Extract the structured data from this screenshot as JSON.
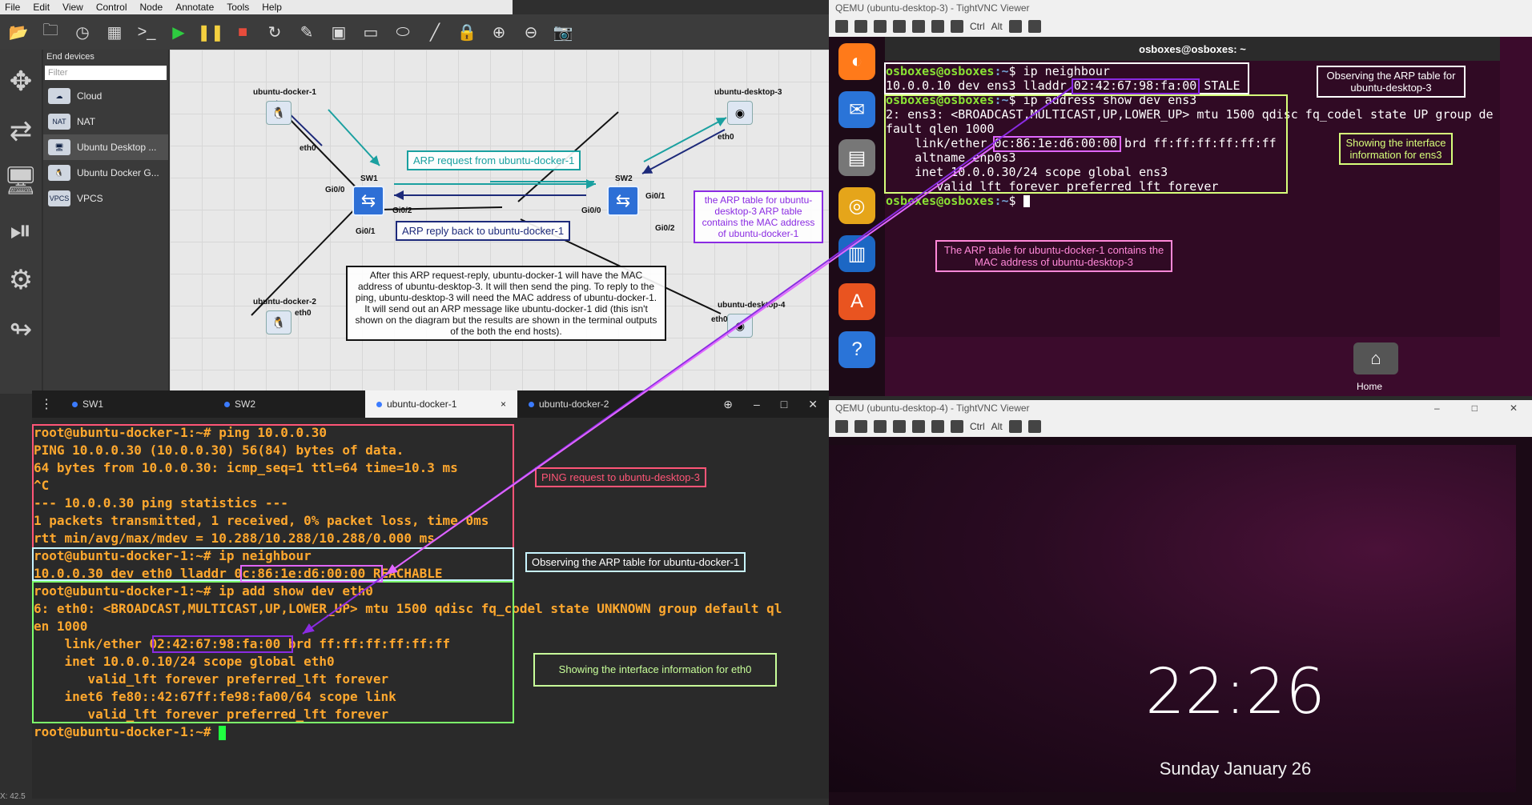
{
  "menu": [
    "File",
    "Edit",
    "View",
    "Control",
    "Node",
    "Annotate",
    "Tools",
    "Help"
  ],
  "devices_panel": {
    "title": "End devices",
    "filter_placeholder": "Filter",
    "items": [
      "Cloud",
      "NAT",
      "Ubuntu Desktop ...",
      "Ubuntu Docker G...",
      "VPCS"
    ]
  },
  "topology": {
    "nodes": {
      "d1": "ubuntu-docker-1",
      "d2": "ubuntu-docker-2",
      "d3": "ubuntu-desktop-3",
      "d4": "ubuntu-desktop-4",
      "sw1": "SW1",
      "sw2": "SW2"
    },
    "ports": {
      "eth0": "eth0",
      "gi00": "Gi0/0",
      "gi01": "Gi0/1",
      "gi02": "Gi0/2"
    },
    "notes": {
      "arp_request": "ARP request from ubuntu-docker-1",
      "arp_reply": "ARP reply back to ubuntu-docker-1",
      "arp_table_d3": "the ARP table for ubuntu-desktop-3 ARP table contains the MAC address of ubuntu-docker-1",
      "explanation": "After this ARP request-reply, ubuntu-docker-1 will have the MAC address of ubuntu-desktop-3. It will then send the ping. To reply to the ping, ubuntu-desktop-3 will need the MAC address of ubuntu-docker-1. It will send out an ARP message like ubuntu-docker-1 did (this isn't shown on the diagram but the results are shown in the terminal outputs of the both the end hosts)."
    }
  },
  "terminal": {
    "tabs": [
      "SW1",
      "SW2",
      "ubuntu-docker-1",
      "ubuntu-docker-2"
    ],
    "active_tab": "ubuntu-docker-1",
    "lines": [
      "root@ubuntu-docker-1:~# ping 10.0.0.30",
      "PING 10.0.0.30 (10.0.0.30) 56(84) bytes of data.",
      "64 bytes from 10.0.0.30: icmp_seq=1 ttl=64 time=10.3 ms",
      "^C",
      "--- 10.0.0.30 ping statistics ---",
      "1 packets transmitted, 1 received, 0% packet loss, time 0ms",
      "rtt min/avg/max/mdev = 10.288/10.288/10.288/0.000 ms",
      "root@ubuntu-docker-1:~# ip neighbour",
      "10.0.0.30 dev eth0 lladdr 0c:86:1e:d6:00:00 REACHABLE",
      "root@ubuntu-docker-1:~# ip add show dev eth0",
      "6: eth0: <BROADCAST,MULTICAST,UP,LOWER_UP> mtu 1500 qdisc fq_codel state UNKNOWN group default ql",
      "en 1000",
      "    link/ether 02:42:67:98:fa:00 brd ff:ff:ff:ff:ff:ff",
      "    inet 10.0.0.10/24 scope global eth0",
      "       valid_lft forever preferred_lft forever",
      "    inet6 fe80::42:67ff:fe98:fa00/64 scope link",
      "       valid_lft forever preferred_lft forever",
      "root@ubuntu-docker-1:~# "
    ],
    "notes": {
      "ping": "PING request to ubuntu-desktop-3",
      "arp": "Observing the ARP table for ubuntu-docker-1",
      "iface": "Showing the interface information for eth0"
    }
  },
  "vnc_top": {
    "title": "QEMU (ubuntu-desktop-3) - TightVNC Viewer",
    "terminal_title": "osboxes@osboxes: ~",
    "prompt_user": "osboxes@osboxes",
    "prompt_path": ":~",
    "lines": [
      "$ ip neighbour",
      "10.0.0.10 dev ens3 lladdr 02:42:67:98:fa:00 STALE",
      "$ ip address show dev ens3",
      "2: ens3: <BROADCAST,MULTICAST,UP,LOWER_UP> mtu 1500 qdisc fq_codel state UP group de",
      "fault qlen 1000",
      "    link/ether 0c:86:1e:d6:00:00 brd ff:ff:ff:ff:ff:ff",
      "    altname enp0s3",
      "    inet 10.0.0.30/24 scope global ens3",
      "       valid_lft forever preferred_lft forever",
      "$ "
    ],
    "notes": {
      "arp": "Observing the ARP table for ubuntu-desktop-3",
      "iface": "Showing the interface information for ens3",
      "d1_arp": "The ARP table for ubuntu-docker-1 contains the MAC address of ubuntu-desktop-3"
    },
    "home_label": "Home"
  },
  "vnc_bottom": {
    "title": "QEMU (ubuntu-desktop-4) - TightVNC Viewer",
    "time": "22:26",
    "date": "Sunday January 26"
  },
  "status_coord": "X: 42.5",
  "colors": {
    "orange": "#ffa82e",
    "teal": "#1aa0a0",
    "navy": "#1d2a7a",
    "purple": "#8a2be2",
    "magenta": "#e066ff",
    "pink": "#ff5577"
  }
}
